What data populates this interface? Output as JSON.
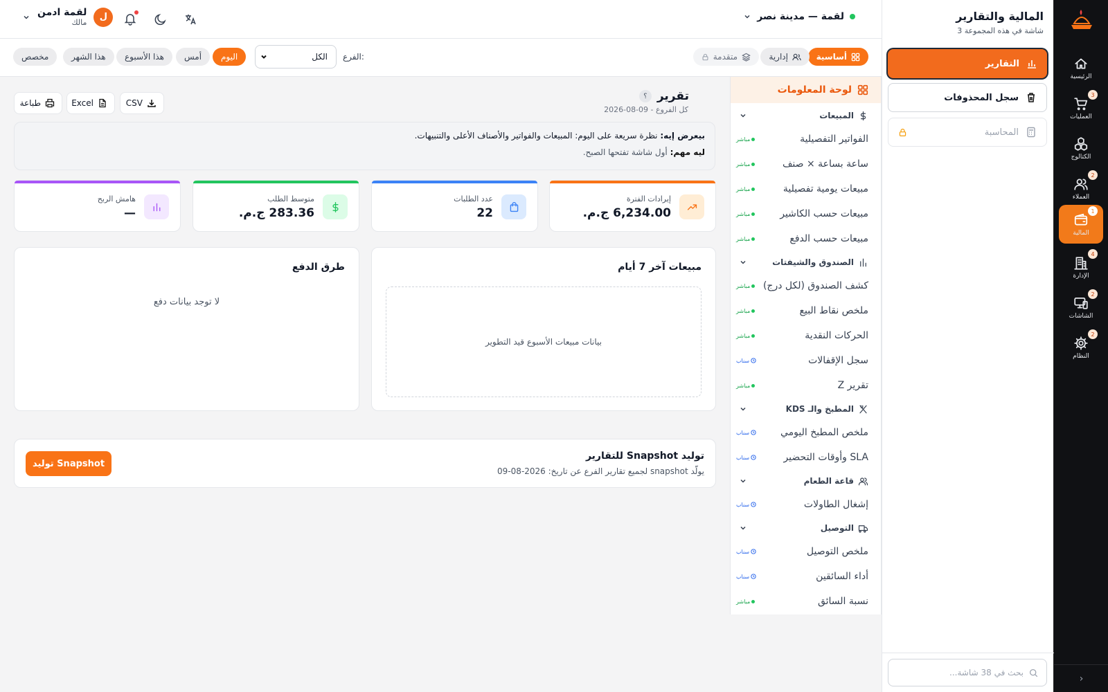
{
  "rail": {
    "items": [
      {
        "label": "الرئيسية",
        "icon": "home-icon",
        "badge": ""
      },
      {
        "label": "العمليات",
        "icon": "cart-icon",
        "badge": "3"
      },
      {
        "label": "الكتالوج",
        "icon": "cubes-icon",
        "badge": ""
      },
      {
        "label": "العملاء",
        "icon": "users-icon",
        "badge": "2"
      },
      {
        "label": "المالية",
        "icon": "wallet-icon",
        "badge": "1"
      },
      {
        "label": "الإدارة",
        "icon": "building-icon",
        "badge": "4"
      },
      {
        "label": "الشاشات",
        "icon": "devices-icon",
        "badge": "2"
      },
      {
        "label": "النظام",
        "icon": "gear-icon",
        "badge": "2"
      }
    ],
    "collapse": "›"
  },
  "group": {
    "title": "المالية والتقارير",
    "subtitle": "3 شاشة في هذه المجموعة",
    "buttons": [
      "التقارير",
      "سجل المحذوفات",
      "المحاسبة"
    ],
    "search_placeholder": "بحث في 38 شاشة..."
  },
  "header": {
    "branch": "لقمة — مدينة نصر",
    "user_name": "لقمة ادمن",
    "user_role": "مالك",
    "avatar_letter": "ل"
  },
  "filters": {
    "tabs": [
      "أساسية",
      "إدارية",
      "متقدمة"
    ],
    "branch_label": "الفرع:",
    "branch_value": "الكل",
    "periods": [
      "اليوم",
      "أمس",
      "هذا الأسبوع",
      "هذا الشهر",
      "مخصص"
    ]
  },
  "nav": {
    "dashboard": "لوحة المعلومات",
    "live": "مباشر",
    "snap": "سناب",
    "sections": [
      {
        "title": "المبيعات",
        "items": [
          {
            "label": "الفواتير التفصيلية",
            "tag": "live"
          },
          {
            "label": "ساعة بساعة × صنف",
            "tag": "live"
          },
          {
            "label": "مبيعات يومية تفصيلية",
            "tag": "live"
          },
          {
            "label": "مبيعات حسب الكاشير",
            "tag": "live"
          },
          {
            "label": "مبيعات حسب الدفع",
            "tag": "live"
          }
        ]
      },
      {
        "title": "الصندوق والشيفتات",
        "items": [
          {
            "label": "كشف الصندوق (لكل درج)",
            "tag": "live"
          },
          {
            "label": "ملخص نقاط البيع",
            "tag": "live"
          },
          {
            "label": "الحركات النقدية",
            "tag": "live"
          },
          {
            "label": "سجل الإقفالات",
            "tag": "snap"
          },
          {
            "label": "تقرير Z",
            "tag": "live"
          }
        ]
      },
      {
        "title": "المطبخ والـ KDS",
        "items": [
          {
            "label": "ملخص المطبخ اليومي",
            "tag": "snap"
          },
          {
            "label": "SLA وأوقات التحضير",
            "tag": "snap"
          }
        ]
      },
      {
        "title": "قاعة الطعام",
        "items": [
          {
            "label": "إشغال الطاولات",
            "tag": "snap"
          }
        ]
      },
      {
        "title": "التوصيل",
        "items": [
          {
            "label": "ملخص التوصيل",
            "tag": "snap"
          },
          {
            "label": "أداء السائقين",
            "tag": "snap"
          },
          {
            "label": "نسبة السائق",
            "tag": "live"
          }
        ]
      }
    ]
  },
  "report": {
    "title": "تقرير",
    "help": "؟",
    "meta": "2026-08-09 - كل الفروع",
    "exports": [
      "CSV",
      "Excel",
      "طباعة"
    ],
    "info_what_label": "بيعرض إيه:",
    "info_what": "نظرة سريعة على اليوم: المبيعات والفواتير والأصناف الأعلى والتنبيهات.",
    "info_why_label": "ليه مهم:",
    "info_why": "أول شاشة تفتحها الصبح."
  },
  "kpis": [
    {
      "label": "إيرادات الفترة",
      "value": "6,234.00 ج.م.",
      "color": "#f97316",
      "icon": "trend-up-icon"
    },
    {
      "label": "عدد الطلبات",
      "value": "22",
      "color": "#3b82f6",
      "icon": "bag-icon"
    },
    {
      "label": "متوسط الطلب",
      "value": "283.36 ج.م.",
      "color": "#22c55e",
      "icon": "dollar-icon"
    },
    {
      "label": "هامش الربح",
      "value": "—",
      "color": "#a855f7",
      "icon": "bar-chart-icon"
    }
  ],
  "sales_card": {
    "title": "مبيعات آخر 7 أيام",
    "placeholder": "بيانات مبيعات الأسبوع قيد التطوير"
  },
  "pay_card": {
    "title": "طرق الدفع",
    "empty": "لا توجد بيانات دفع"
  },
  "snapshot": {
    "title": "توليد Snapshot للتقارير",
    "desc": "يولّد snapshot لجميع تقارير الفرع عن تاريخ: 2026-08-09",
    "button": "توليد Snapshot"
  },
  "colors": {
    "accent": "#f97316",
    "rail": "#101114"
  }
}
